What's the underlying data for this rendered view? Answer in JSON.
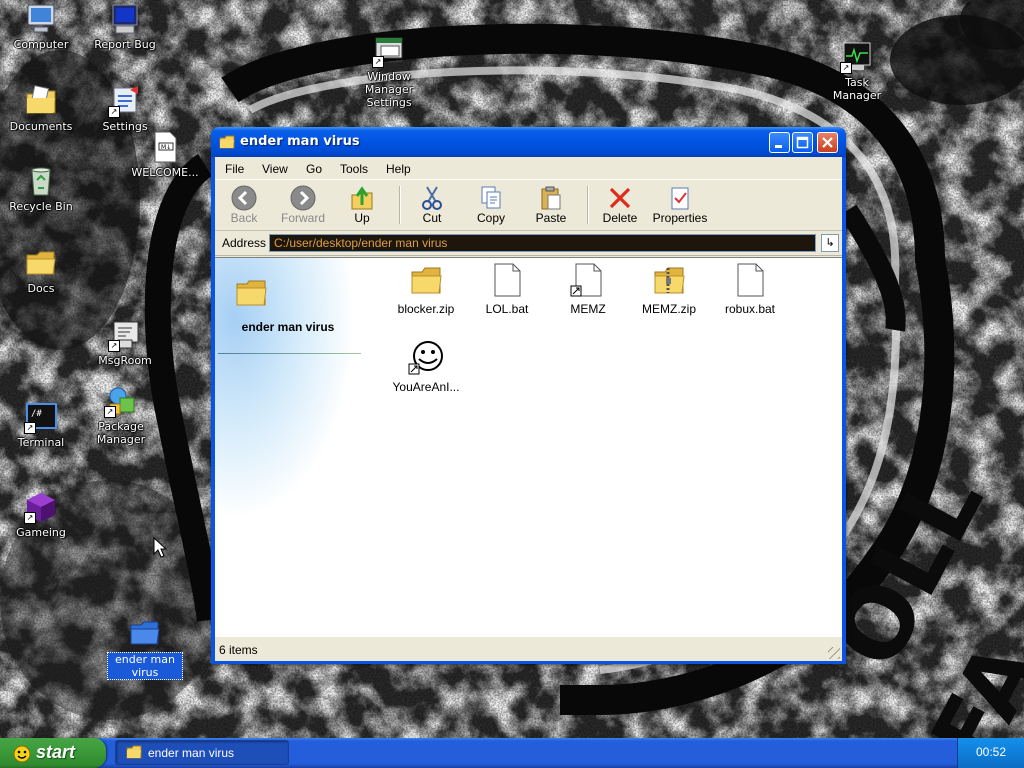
{
  "desktop": {
    "icons": [
      {
        "label": "Computer"
      },
      {
        "label": "Report Bug"
      },
      {
        "label": "Documents"
      },
      {
        "label": "Settings"
      },
      {
        "label": "WELCOME..."
      },
      {
        "label": "Recycle Bin"
      },
      {
        "label": "Docs"
      },
      {
        "label": "MsgRoom"
      },
      {
        "label": "Terminal"
      },
      {
        "label": "Package Manager"
      },
      {
        "label": "Gameing"
      },
      {
        "label": "ender man virus"
      },
      {
        "label": "Window Manager Settings"
      },
      {
        "label": "Task Manager"
      }
    ]
  },
  "window": {
    "title": "ender man virus",
    "menu": [
      "File",
      "View",
      "Go",
      "Tools",
      "Help"
    ],
    "toolbar": {
      "back": "Back",
      "forward": "Forward",
      "up": "Up",
      "cut": "Cut",
      "copy": "Copy",
      "paste": "Paste",
      "delete": "Delete",
      "properties": "Properties"
    },
    "address_label": "Address",
    "address_value": "C:/user/desktop/ender man virus",
    "go_icon": "go-arrow-icon",
    "taskpane_title": "ender man virus",
    "files": [
      {
        "name": "blocker.zip",
        "icon": "folder-icon"
      },
      {
        "name": "LOL.bat",
        "icon": "document-icon"
      },
      {
        "name": "MEMZ",
        "icon": "document-shortcut-icon"
      },
      {
        "name": "MEMZ.zip",
        "icon": "zip-folder-icon"
      },
      {
        "name": "robux.bat",
        "icon": "document-icon"
      },
      {
        "name": "YouAreAnI...",
        "icon": "smiley-shortcut-icon"
      }
    ],
    "status": "6 items"
  },
  "taskbar": {
    "start_label": "start",
    "task_label": "ender man virus",
    "clock": "00:52"
  },
  "colors": {
    "titlebar": "#0054e3",
    "taskbar": "#245edb",
    "start": "#3c9b3a",
    "address_bg": "#1e160c",
    "address_text": "#d8a047"
  }
}
